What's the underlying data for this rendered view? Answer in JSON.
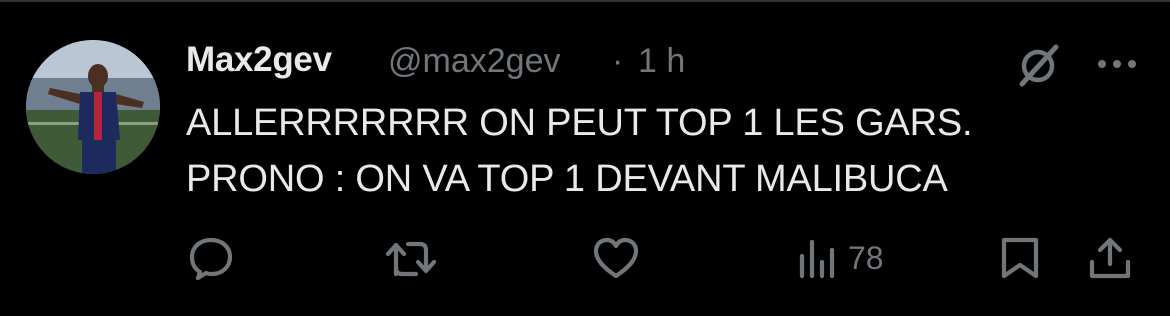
{
  "tweet": {
    "display_name": "Max2gev",
    "handle": "@max2gev",
    "separator": "·",
    "time": "1 h",
    "text_line1": "ALLERRRRRRR ON PEUT TOP 1 LES GARS.",
    "text_line2": "PRONO : ON VA TOP 1 DEVANT MALIBUCA",
    "views": "78"
  },
  "icons": {
    "grok": "grok-icon",
    "more": "more-icon",
    "reply": "reply-icon",
    "retweet": "retweet-icon",
    "like": "heart-icon",
    "views": "views-icon",
    "bookmark": "bookmark-icon",
    "share": "share-icon"
  },
  "colors": {
    "background": "#000000",
    "primary_text": "#e7e9ea",
    "secondary_text": "#71767b",
    "divider": "#2f3336"
  }
}
